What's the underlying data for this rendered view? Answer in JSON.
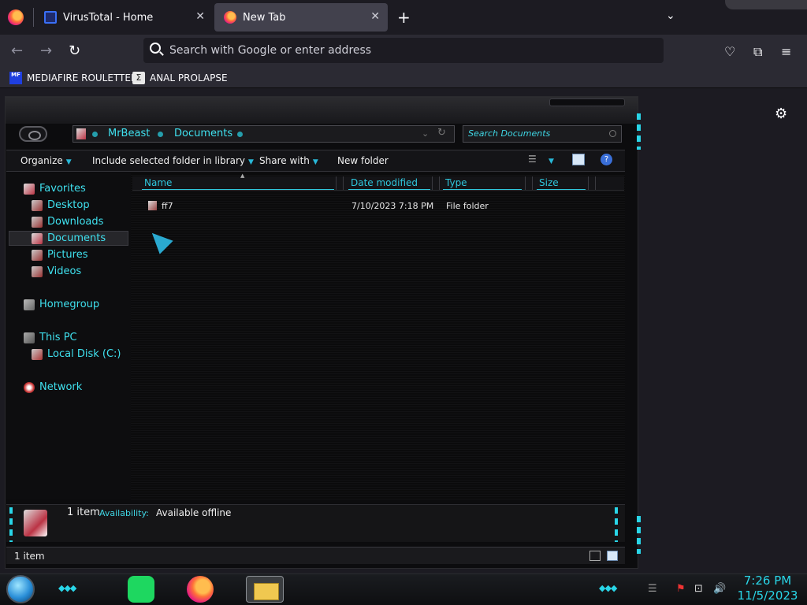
{
  "browser": {
    "tabs": [
      {
        "label": "VirusTotal - Home",
        "active": false
      },
      {
        "label": "New Tab",
        "active": true
      }
    ],
    "url_placeholder": "Search with Google or enter address",
    "bookmarks": [
      {
        "label": "MEDIAFIRE ROULETTER",
        "icon_text": "MF"
      },
      {
        "label": "ANAL PROLAPSE",
        "icon_text": "Σ"
      }
    ]
  },
  "explorer": {
    "breadcrumb": [
      "MrBeast",
      "Documents"
    ],
    "search_placeholder": "Search Documents",
    "toolbar": {
      "organize": "Organize",
      "include": "Include selected folder in library",
      "share": "Share with",
      "new_folder": "New folder"
    },
    "nav": {
      "favorites": "Favorites",
      "desktop": "Desktop",
      "downloads": "Downloads",
      "documents": "Documents",
      "pictures": "Pictures",
      "videos": "Videos",
      "homegroup": "Homegroup",
      "this_pc": "This PC",
      "local_disk": "Local Disk (C:)",
      "network": "Network"
    },
    "columns": [
      "Name",
      "Date modified",
      "Type",
      "Size"
    ],
    "files": [
      {
        "name": "ff7",
        "date": "7/10/2023 7:18 PM",
        "type": "File folder",
        "size": ""
      }
    ],
    "details": {
      "count": "1 item",
      "availability_label": "Availability:",
      "availability_value": "Available offline"
    },
    "status": "1 item"
  },
  "taskbar": {
    "time": "7:26 PM",
    "date": "11/5/2023"
  }
}
